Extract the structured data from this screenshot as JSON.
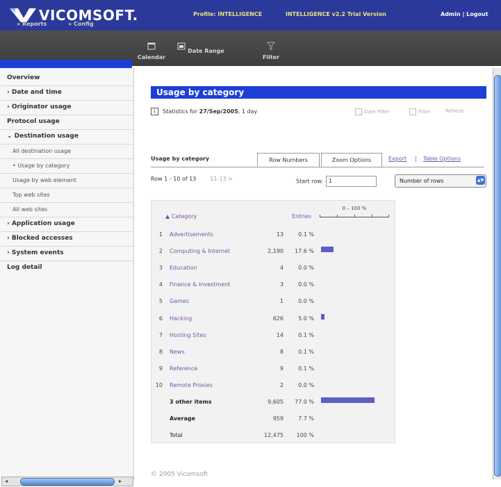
{
  "header": {
    "brand": "VICOMSOFT.",
    "profile_label": "Profile: INTELLIGENCE",
    "version": "INTELLIGENCE v2.2 Trial Version",
    "user_links": "Admin | Logout",
    "subnav": [
      "Reports",
      "Config"
    ],
    "tools": [
      {
        "label": "Calendar",
        "icon": "calendar-icon"
      },
      {
        "label": "Date Range",
        "icon": "date-range-icon"
      },
      {
        "label": "Filter",
        "icon": "filter-icon"
      }
    ]
  },
  "sidebar": {
    "items": [
      {
        "label": "Overview",
        "level": 0
      },
      {
        "label": "› Date and time",
        "level": 0
      },
      {
        "label": "› Originator usage",
        "level": 0
      },
      {
        "label": "Protocol usage",
        "level": 0
      },
      {
        "label": "⌄ Destination usage",
        "level": 0
      },
      {
        "label": "All destination usage",
        "level": 1
      },
      {
        "label": "• Usage by category",
        "level": 1
      },
      {
        "label": "Usage by web element",
        "level": 1
      },
      {
        "label": "Top web sites",
        "level": 1
      },
      {
        "label": "All web sites",
        "level": 1
      },
      {
        "label": "› Application usage",
        "level": 0
      },
      {
        "label": "› Blocked accesses",
        "level": 0
      },
      {
        "label": "› System events",
        "level": 0
      },
      {
        "label": "Log detail",
        "level": 0
      }
    ]
  },
  "main": {
    "title": "Usage by category",
    "stats_prefix": "Statistics for ",
    "stats_date": "27/Sep/2005",
    "stats_suffix": ", 1 day",
    "options": [
      "Date Filter",
      "Filter",
      "Refresh"
    ],
    "tab_title": "Usage by category",
    "tabs": [
      "Row Numbers",
      "Zoom Options"
    ],
    "links": [
      "Export",
      "|",
      "Table Options"
    ],
    "row_info": "Row 1 - 10 of 13",
    "next_link": "11-13 >",
    "start_row_label": "Start row:",
    "start_row_value": "1",
    "num_rows_label": "Number of rows",
    "table": {
      "col_category": "▲ Category",
      "col_entries": "Entries",
      "scale_label": "0 – 100 %",
      "rows": [
        {
          "num": "1",
          "name": "Advertisements",
          "count": "13",
          "pct": "0.1 %",
          "share": 0.1
        },
        {
          "num": "2",
          "name": "Computing & Internet",
          "count": "2,190",
          "pct": "17.6 %",
          "share": 17.6
        },
        {
          "num": "3",
          "name": "Education",
          "count": "4",
          "pct": "0.0 %",
          "share": 0
        },
        {
          "num": "4",
          "name": "Finance & Investment",
          "count": "3",
          "pct": "0.0 %",
          "share": 0
        },
        {
          "num": "5",
          "name": "Games",
          "count": "1",
          "pct": "0.0 %",
          "share": 0
        },
        {
          "num": "6",
          "name": "Hacking",
          "count": "626",
          "pct": "5.0 %",
          "share": 5.0
        },
        {
          "num": "7",
          "name": "Hosting Sites",
          "count": "14",
          "pct": "0.1 %",
          "share": 0.1
        },
        {
          "num": "8",
          "name": "News",
          "count": "8",
          "pct": "0.1 %",
          "share": 0.1
        },
        {
          "num": "9",
          "name": "Reference",
          "count": "9",
          "pct": "0.1 %",
          "share": 0.1
        },
        {
          "num": "10",
          "name": "Remote Proxies",
          "count": "2",
          "pct": "0.0 %",
          "share": 0
        }
      ],
      "summary": [
        {
          "name": "3 other items",
          "count": "9,605",
          "pct": "77.0 %",
          "share": 77.0,
          "style": "bold"
        },
        {
          "name": "Average",
          "count": "959",
          "pct": "7.7 %",
          "share": 0,
          "style": "bold"
        },
        {
          "name": "Total",
          "count": "12,475",
          "pct": "100 %",
          "share": 0,
          "style": "plain"
        }
      ]
    },
    "footer": "© 2005 Vicomsoft"
  },
  "colors": {
    "accent": "#1d3fd6",
    "bar": "#5c5fc4",
    "link": "#7a52a8"
  }
}
